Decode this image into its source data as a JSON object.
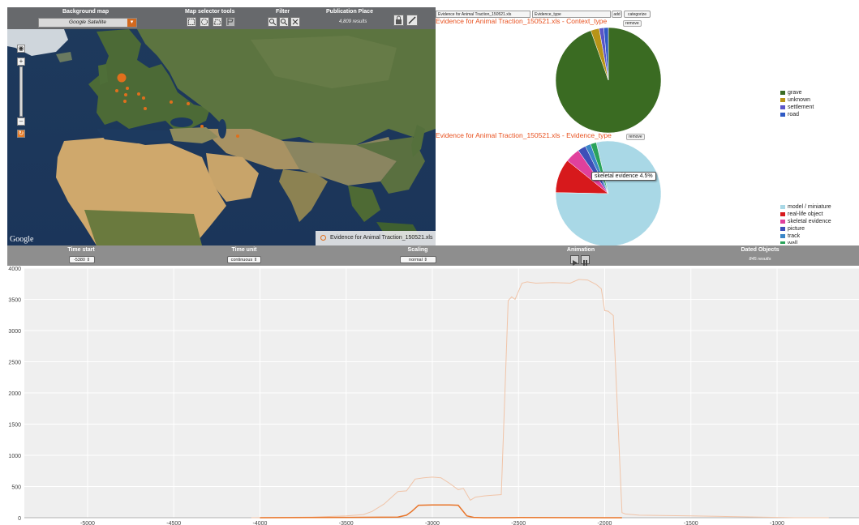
{
  "map": {
    "toolbar": {
      "background_map_label": "Background map",
      "background_map_value": "Google Satellite",
      "selector_tools_label": "Map selector tools",
      "filter_label": "Filter",
      "publication_place_label": "Publication Place",
      "results": "4,809 results"
    },
    "google_logo": "Google",
    "legend_label": "Evidence for Animal Traction_150521.xls",
    "colors": {
      "marker": "#e06f1c"
    }
  },
  "pie_controls": {
    "dataset_select": "Evidence for Animal Traction_150521.xls",
    "field_select": "Evidence_type",
    "add_button": "add",
    "categorize_button": "categorize"
  },
  "pies": [
    {
      "title": "Evidence for Animal Traction_150521.xls - Context_type",
      "remove_label": "remove",
      "legend": [
        {
          "label": "grave",
          "color": "#3a6b22"
        },
        {
          "label": "unknown",
          "color": "#b89418"
        },
        {
          "label": "settlement",
          "color": "#5a55c8"
        },
        {
          "label": "road",
          "color": "#2f5ac4"
        }
      ],
      "slices": [
        0.946,
        0.026,
        0.014,
        0.014
      ]
    },
    {
      "title": "Evidence for Animal Traction_150521.xls - Evidence_type",
      "remove_label": "remove",
      "legend": [
        {
          "label": "model / miniature",
          "color": "#a9d8e6"
        },
        {
          "label": "real-life object",
          "color": "#d7191c"
        },
        {
          "label": "skeletal evidence",
          "color": "#e0409c"
        },
        {
          "label": "picture",
          "color": "#3d4fb8"
        },
        {
          "label": "track",
          "color": "#3a86c8"
        },
        {
          "label": "wall",
          "color": "#2aa35a"
        }
      ],
      "slices": [
        0.79,
        0.105,
        0.045,
        0.025,
        0.017,
        0.018
      ],
      "tooltip": "skeletal evidence 4.5%"
    }
  ],
  "timeline_toolbar": {
    "time_start_label": "Time start",
    "time_start_value": "-5380",
    "time_unit_label": "Time unit",
    "time_unit_value": "continuous",
    "scaling_label": "Scaling",
    "scaling_value": "normal",
    "animation_label": "Animation",
    "dated_objects_label": "Dated Objects",
    "dated_objects_value": "845 results"
  },
  "chart_data": {
    "type": "line",
    "xlim": [
      -5400,
      0
    ],
    "ylim": [
      0,
      4000
    ],
    "x_ticks": [
      -5000,
      -4500,
      -4000,
      -3500,
      -3000,
      -2500,
      -2000,
      -1500,
      -1000
    ],
    "y_ticks": [
      0,
      500,
      1000,
      1500,
      2000,
      2500,
      3000,
      3500,
      4000
    ],
    "grid": true,
    "series": [
      {
        "color": "#f0c4a8",
        "x": [
          -4050,
          -3700,
          -3500,
          -3400,
          -3350,
          -3280,
          -3200,
          -3150,
          -3100,
          -3050,
          -3000,
          -2950,
          -2900,
          -2850,
          -2820,
          -2780,
          -2750,
          -2700,
          -2650,
          -2600,
          -2560,
          -2540,
          -2520,
          -2480,
          -2450,
          -2400,
          -2300,
          -2200,
          -2150,
          -2100,
          -2050,
          -2020,
          -2000,
          -1980,
          -1950,
          -1900,
          -1880,
          -1800,
          -1500,
          -1300,
          -1100,
          -1000,
          -900,
          -700
        ],
        "y": [
          0,
          10,
          30,
          50,
          100,
          220,
          420,
          430,
          620,
          640,
          650,
          640,
          550,
          450,
          470,
          280,
          330,
          350,
          360,
          370,
          3480,
          3540,
          3500,
          3760,
          3780,
          3760,
          3770,
          3760,
          3820,
          3810,
          3740,
          3670,
          3320,
          3310,
          3240,
          80,
          60,
          40,
          30,
          20,
          10,
          5,
          0,
          0
        ]
      },
      {
        "color": "#e8752a",
        "x": [
          -4000,
          -3500,
          -3200,
          -3150,
          -3120,
          -3080,
          -3000,
          -2900,
          -2850,
          -2800,
          -2760,
          -2700,
          -2500,
          -2000,
          -1900
        ],
        "y": [
          0,
          5,
          10,
          40,
          100,
          200,
          205,
          205,
          200,
          30,
          5,
          0,
          2,
          0,
          0
        ]
      }
    ]
  }
}
